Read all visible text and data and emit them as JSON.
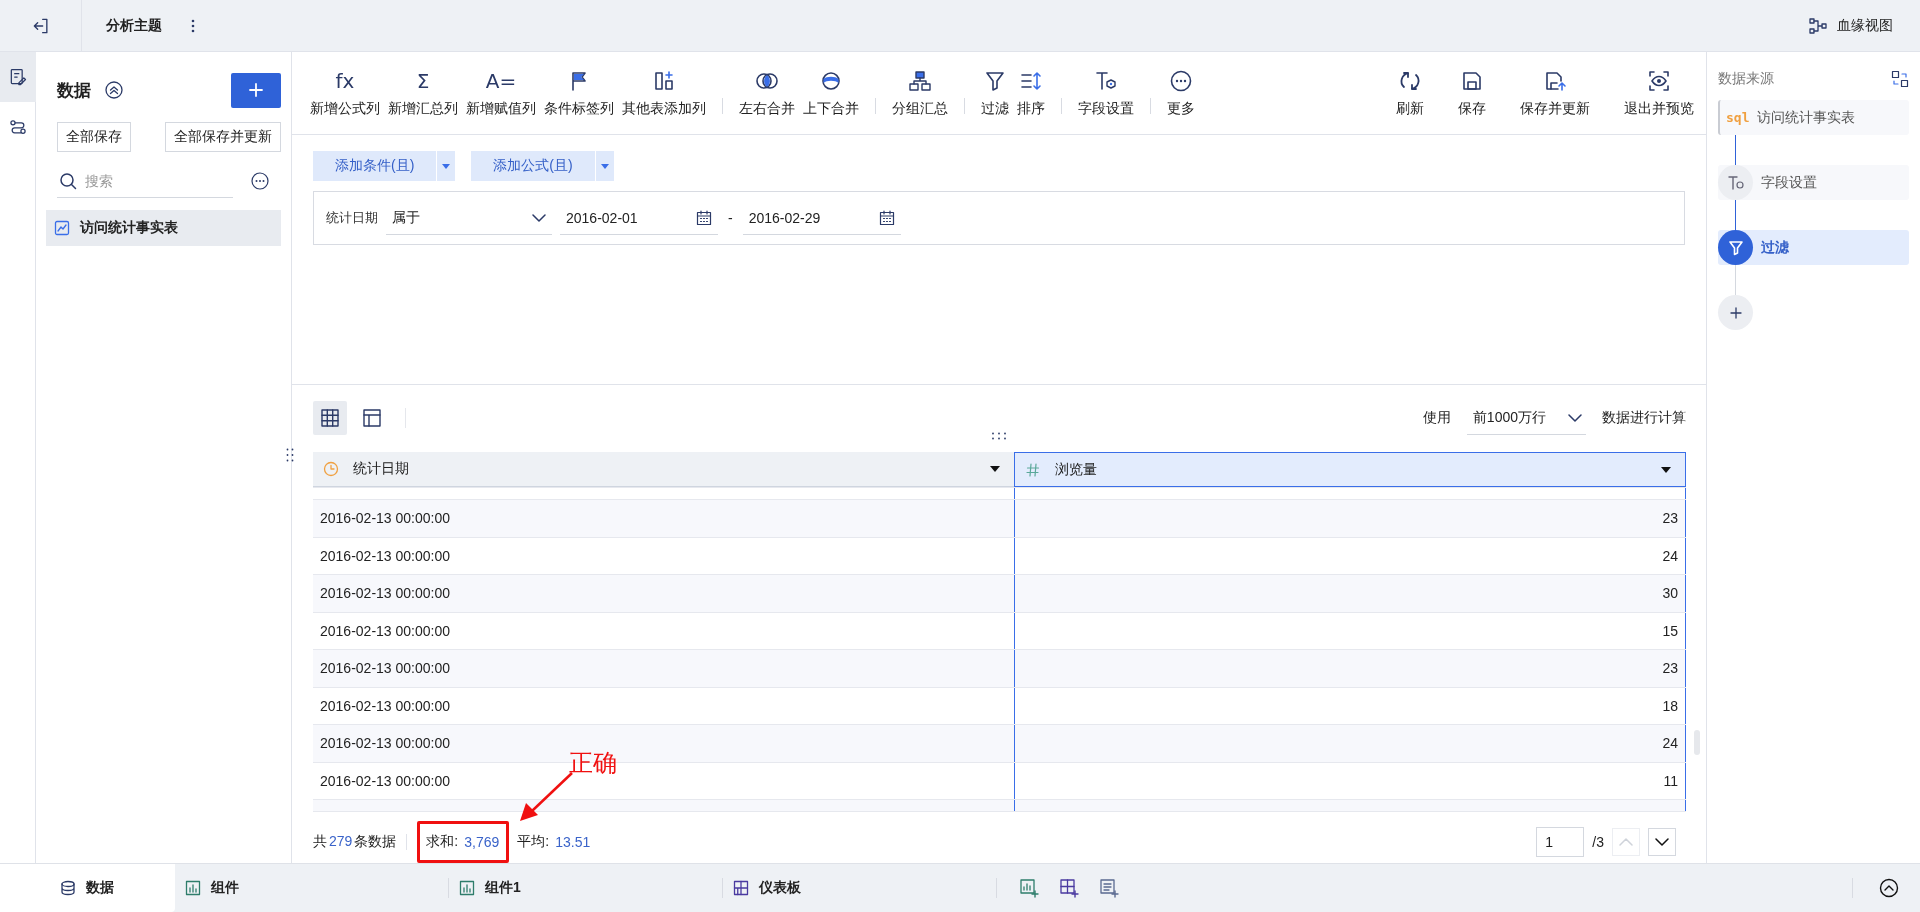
{
  "top_bar": {
    "title": "分析主题",
    "lineage_link": "血缘视图"
  },
  "side_rail": [
    {
      "kind": "edit",
      "selected": true
    },
    {
      "kind": "link",
      "selected": false
    }
  ],
  "data_panel": {
    "title": "数据",
    "buttons": [
      "全部保存",
      "全部保存并更新"
    ],
    "search": {
      "placeholder": "搜索"
    },
    "tables": [
      {
        "label": "访问统计事实表",
        "selected": true
      }
    ]
  },
  "toolbar": {
    "groups": [
      [
        {
          "label": "新增公式列",
          "glyph": "fx"
        },
        {
          "label": "新增汇总列",
          "glyph": "Σ"
        },
        {
          "label": "新增赋值列",
          "glyph": "A="
        },
        {
          "label": "条件标签列",
          "kind": "flag"
        },
        {
          "label": "其他表添加列",
          "kind": "table-add"
        }
      ],
      [
        {
          "label": "左右合并",
          "kind": "merge-lr"
        },
        {
          "label": "上下合并",
          "kind": "merge-ud"
        }
      ],
      [
        {
          "label": "分组汇总",
          "kind": "group"
        }
      ],
      [
        {
          "label": "过滤",
          "kind": "filter"
        },
        {
          "label": "排序",
          "kind": "sort"
        }
      ],
      [
        {
          "label": "字段设置",
          "kind": "field"
        }
      ],
      [
        {
          "label": "更多",
          "kind": "more"
        }
      ]
    ],
    "right": [
      {
        "label": "刷新",
        "kind": "refresh"
      },
      {
        "label": "保存",
        "kind": "save"
      },
      {
        "label": "保存并更新",
        "kind": "save-update"
      },
      {
        "label": "退出并预览",
        "kind": "exit-preview"
      }
    ]
  },
  "filter_editor": {
    "add_buttons": [
      "添加条件(且)",
      "添加公式(且)"
    ],
    "condition": {
      "field": "统计日期",
      "operator": "属于",
      "start": "2016-02-01",
      "separator": "-",
      "end": "2016-02-29"
    }
  },
  "preview": {
    "view_modes": [
      {
        "kind": "table",
        "selected": true
      },
      {
        "kind": "layout",
        "selected": false
      }
    ],
    "row_limit": {
      "prefix": "使用",
      "value": "前1000万行",
      "suffix": "数据进行计算"
    },
    "table": {
      "columns": [
        {
          "label": "统计日期",
          "kind": "date",
          "selected": false
        },
        {
          "label": "浏览量",
          "kind": "number",
          "selected": true
        }
      ],
      "rows": [
        [
          "2016-02-13 00:00:00",
          "23"
        ],
        [
          "2016-02-13 00:00:00",
          "24"
        ],
        [
          "2016-02-13 00:00:00",
          "30"
        ],
        [
          "2016-02-13 00:00:00",
          "15"
        ],
        [
          "2016-02-13 00:00:00",
          "23"
        ],
        [
          "2016-02-13 00:00:00",
          "18"
        ],
        [
          "2016-02-13 00:00:00",
          "24"
        ],
        [
          "2016-02-13 00:00:00",
          "11"
        ]
      ]
    },
    "summary": {
      "count_prefix": "共",
      "count": "279",
      "count_suffix": "条数据",
      "sum_label": "求和:",
      "sum": "3,769",
      "avg_label": "平均:",
      "avg": "13.51"
    },
    "pagination": {
      "page": "1",
      "total": "/3"
    },
    "annotation": {
      "text": "正确"
    }
  },
  "steps_panel": {
    "title": "数据来源",
    "steps": [
      {
        "label": "访问统计事实表",
        "kind": "source",
        "badge": "sql",
        "selected": false
      },
      {
        "label": "字段设置",
        "kind": "field",
        "selected": false
      },
      {
        "label": "过滤",
        "kind": "filter",
        "selected": true
      }
    ]
  },
  "bottom_tabs": [
    {
      "label": "数据",
      "kind": "data",
      "selected": true
    },
    {
      "label": "组件",
      "kind": "widget",
      "selected": false
    },
    {
      "label": "组件1",
      "kind": "widget",
      "selected": false
    },
    {
      "label": "仪表板",
      "kind": "dashboard",
      "selected": false
    }
  ]
}
